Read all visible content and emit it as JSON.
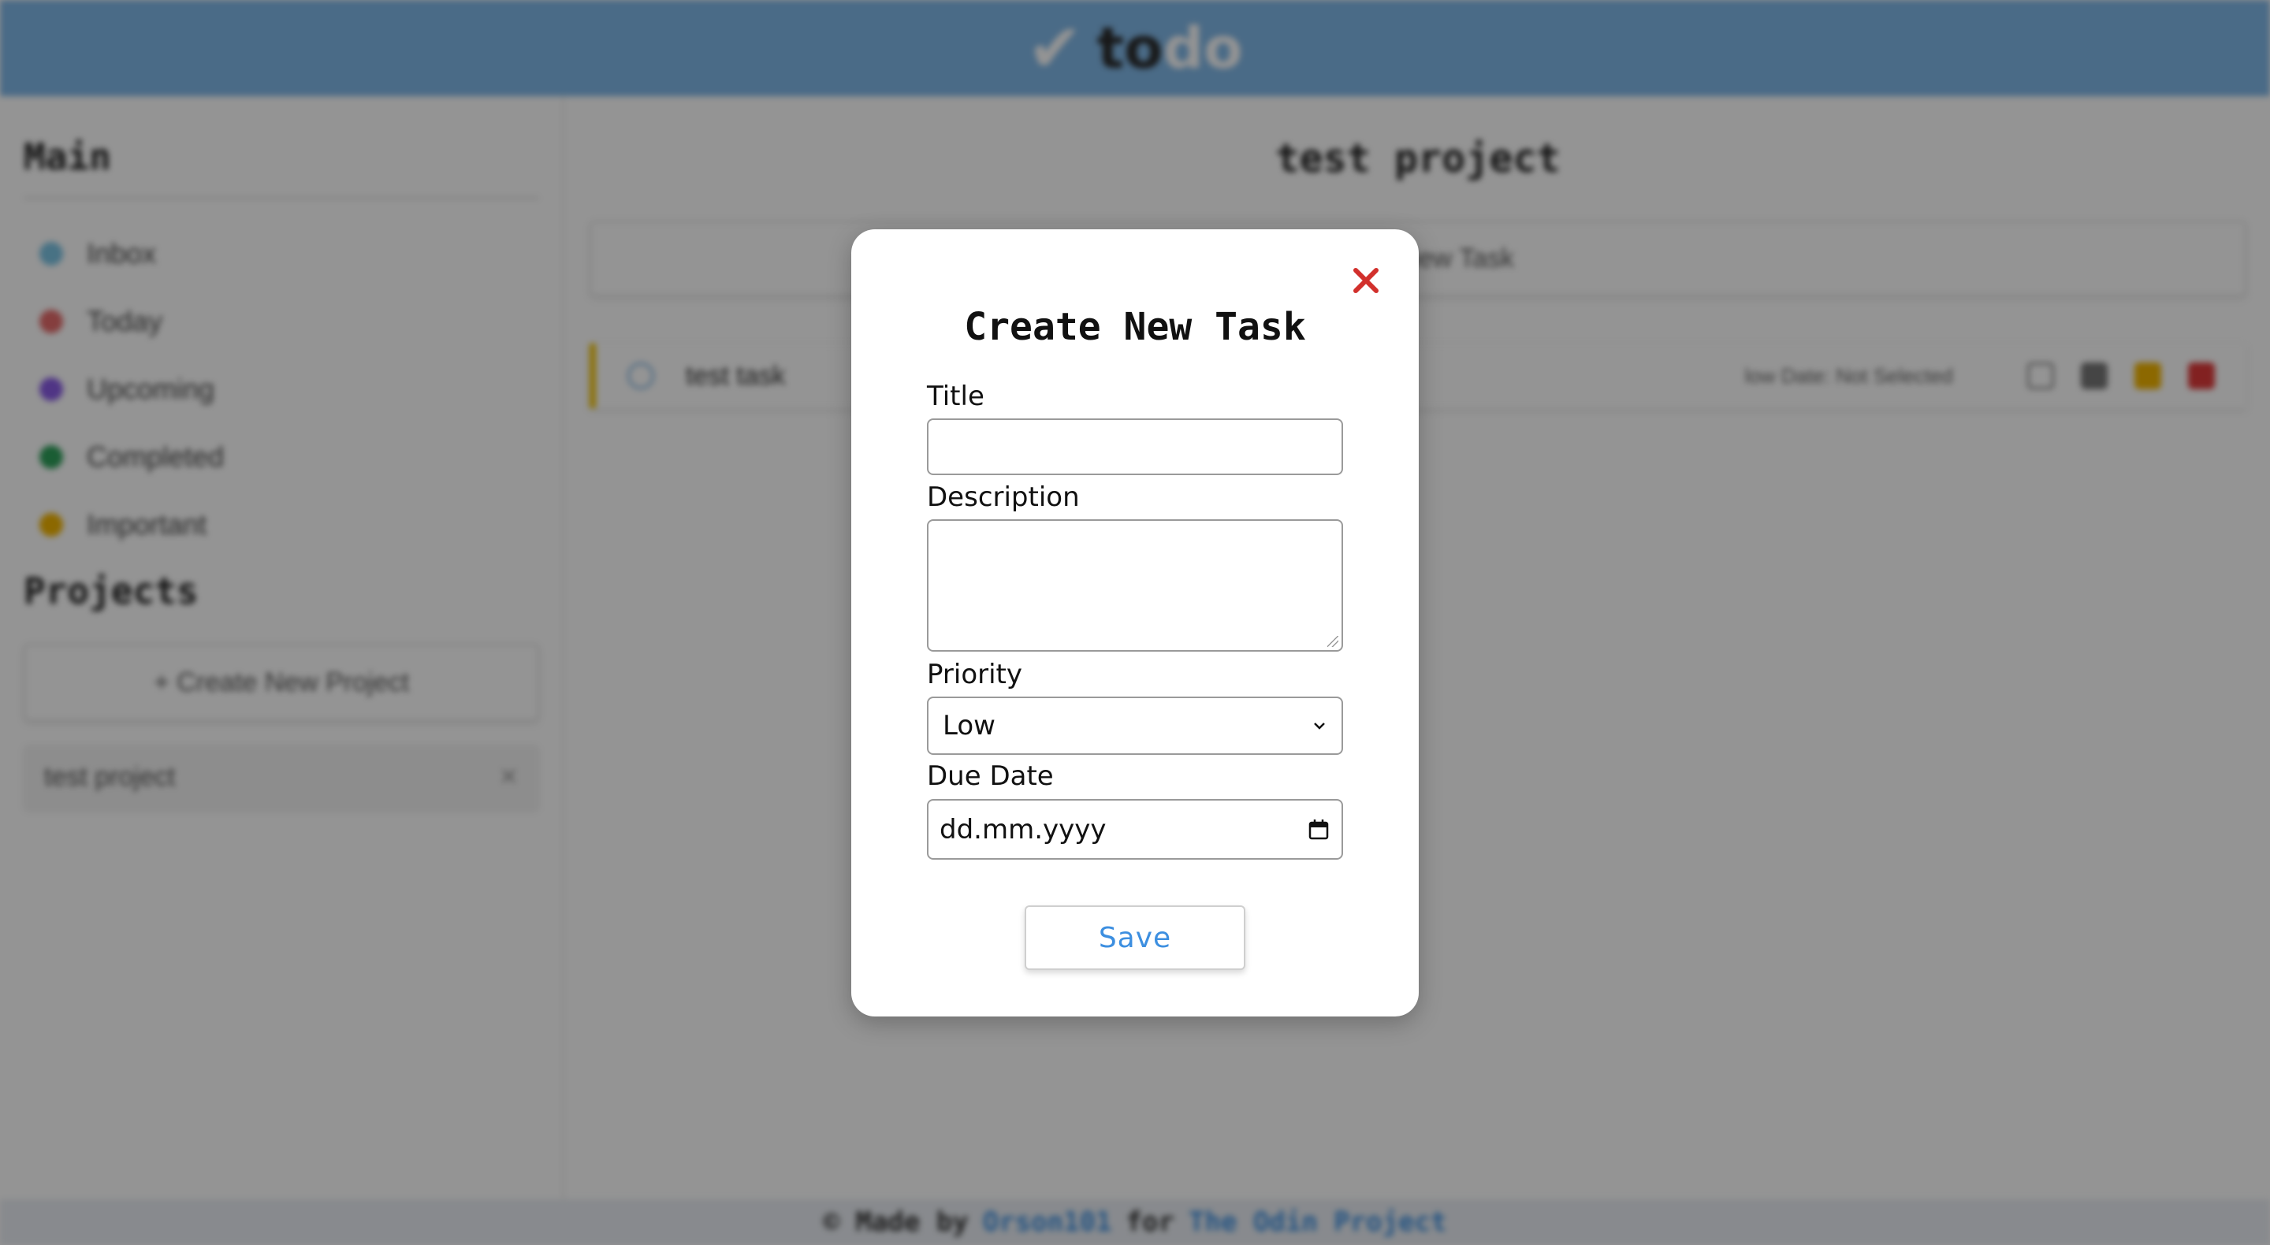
{
  "header": {
    "logo_check": "✔",
    "logo_to": "to",
    "logo_do": "do"
  },
  "sidebar": {
    "main_heading": "Main",
    "items": [
      {
        "label": "Inbox",
        "color": "#7cc4e4",
        "icon": "inbox-dot-icon"
      },
      {
        "label": "Today",
        "color": "#e56b6b",
        "icon": "today-dot-icon"
      },
      {
        "label": "Upcoming",
        "color": "#8a5ce6",
        "icon": "upcoming-dot-icon"
      },
      {
        "label": "Completed",
        "color": "#2ea05a",
        "icon": "completed-dot-icon"
      },
      {
        "label": "Important",
        "color": "#f2b400",
        "icon": "important-dot-icon"
      }
    ],
    "projects_heading": "Projects",
    "create_project_label": "+ Create New Project",
    "projects": [
      {
        "label": "test project",
        "action_icon": "remove-project-icon"
      }
    ]
  },
  "main": {
    "title": "test project",
    "add_task_label": "+ Add New Task",
    "tasks": [
      {
        "title": "test task",
        "meta": "low Date: Not Selected",
        "priority_color": "#f2c200"
      }
    ]
  },
  "footer": {
    "prefix": "© Made by",
    "author": "Orson101",
    "middle": "for",
    "project": "The Odin Project"
  },
  "modal": {
    "title": "Create New Task",
    "close_icon": "✕",
    "title_label": "Title",
    "title_value": "",
    "description_label": "Description",
    "description_value": "",
    "priority_label": "Priority",
    "priority_value": "Low",
    "due_date_label": "Due Date",
    "due_date_placeholder": "dd.mm.yyyy",
    "save_label": "Save"
  }
}
